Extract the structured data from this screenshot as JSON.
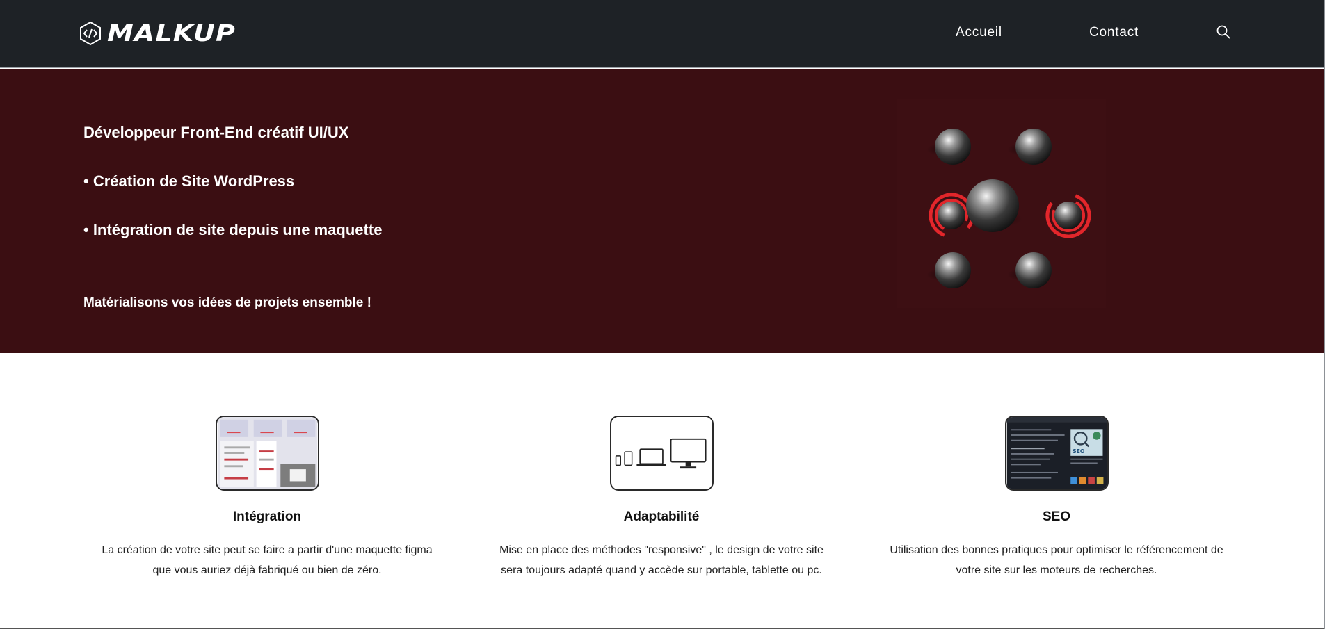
{
  "header": {
    "logo_text": "MALKUP",
    "nav": [
      "Accueil",
      "Contact"
    ],
    "search_icon": "search-icon"
  },
  "hero": {
    "lines": [
      "Développeur Front-End créatif UI/UX",
      "• Création de Site WordPress",
      "• Intégration de site depuis une maquette"
    ],
    "tagline": "Matérialisons vos idées de projets ensemble !",
    "background": "#3b0e12",
    "accent": "#e3262b"
  },
  "features": [
    {
      "title": "Intégration",
      "text": "La création de votre site peut se faire a partir d'une maquette figma que vous auriez déjà fabriqué ou bien de zéro.",
      "icon": "figma-mockup-thumbnail"
    },
    {
      "title": "Adaptabilité",
      "text": "Mise en place des méthodes \"responsive\" , le design de votre site sera toujours adapté quand y accède sur portable, tablette ou pc.",
      "icon": "responsive-devices-thumbnail"
    },
    {
      "title": "SEO",
      "text": "Utilisation des bonnes pratiques pour optimiser le référencement de votre site sur les moteurs de recherches.",
      "icon": "seo-thumbnail"
    }
  ],
  "seo_thumb_label": "SEO"
}
